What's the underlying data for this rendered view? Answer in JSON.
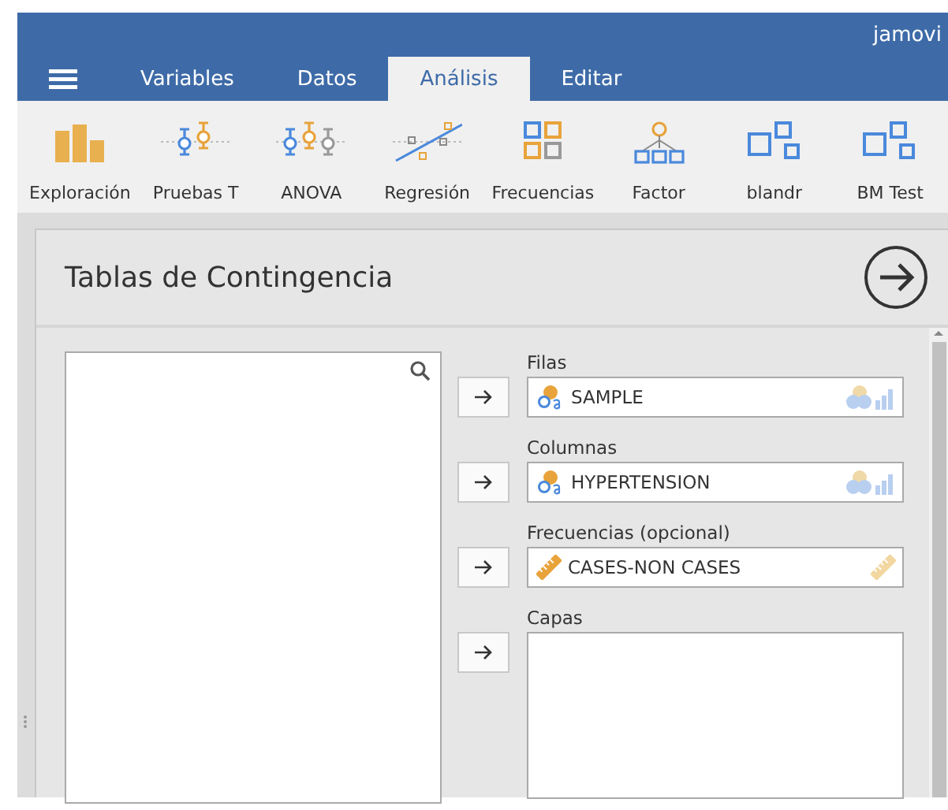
{
  "window": {
    "title": "jamovi"
  },
  "tabs": [
    {
      "label": "Variables",
      "selected": false
    },
    {
      "label": "Datos",
      "selected": false
    },
    {
      "label": "Análisis",
      "selected": true
    },
    {
      "label": "Editar",
      "selected": false
    }
  ],
  "toolbar": [
    {
      "label": "Exploración",
      "kind": "bars"
    },
    {
      "label": "Pruebas T",
      "kind": "ttest"
    },
    {
      "label": "ANOVA",
      "kind": "anova"
    },
    {
      "label": "Regresión",
      "kind": "regression"
    },
    {
      "label": "Frecuencias",
      "kind": "grid"
    },
    {
      "label": "Factor",
      "kind": "tree"
    },
    {
      "label": "blandr",
      "kind": "module"
    },
    {
      "label": "BM Test",
      "kind": "module"
    }
  ],
  "panel": {
    "title": "Tablas de Contingencia",
    "targets": [
      {
        "label": "Filas",
        "multi": false,
        "items": [
          {
            "name": "SAMPLE",
            "kind": "nominal"
          }
        ]
      },
      {
        "label": "Columnas",
        "multi": false,
        "items": [
          {
            "name": "HYPERTENSION",
            "kind": "nominal"
          }
        ]
      },
      {
        "label": "Frecuencias (opcional)",
        "multi": false,
        "items": [
          {
            "name": "CASES-NON CASES",
            "kind": "continuous"
          }
        ]
      },
      {
        "label": "Capas",
        "multi": true
      }
    ]
  }
}
